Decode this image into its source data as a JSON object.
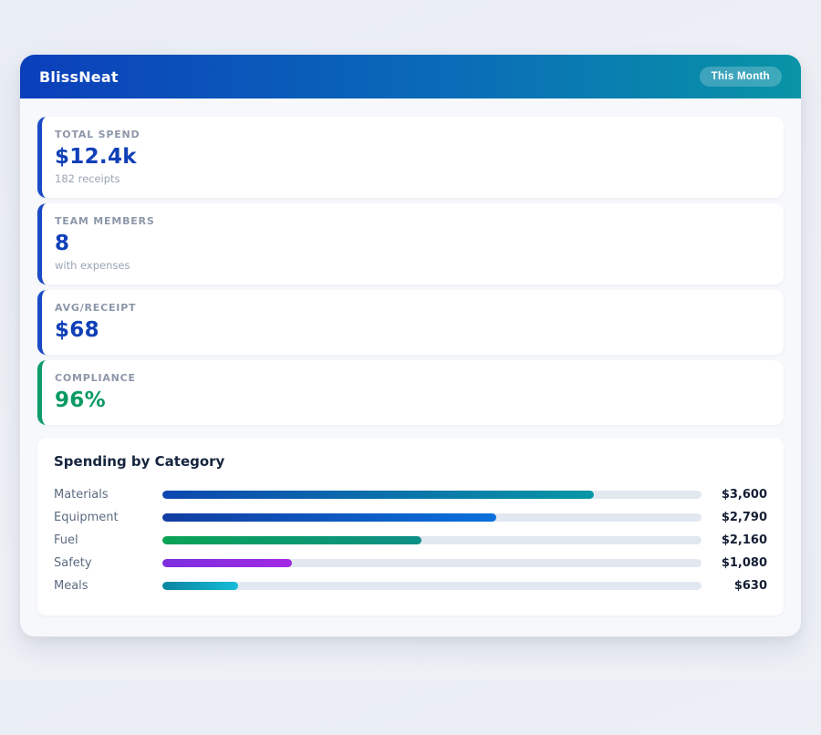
{
  "app": {
    "title": "BlissNeat",
    "period_badge": "This Month",
    "header_gradient": [
      "#0b3fbb",
      "#0894a6"
    ]
  },
  "stats": [
    {
      "label": "TOTAL SPEND",
      "value": "$12.4k",
      "sub": "182 receipts",
      "accent": "#1b4ac6",
      "value_color": "#1040b8"
    },
    {
      "label": "TEAM MEMBERS",
      "value": "8",
      "sub": "with expenses",
      "accent": "#1b4ac6",
      "value_color": "#1040b8"
    },
    {
      "label": "AVG/RECEIPT",
      "value": "$68",
      "accent": "#1b4ac6",
      "value_color": "#1040b8"
    },
    {
      "label": "COMPLIANCE",
      "value": "96%",
      "accent": "#0e9d68",
      "value_color": "#0a9a62"
    }
  ],
  "chart": {
    "title": "Spending by Category",
    "rows": [
      {
        "label": "Materials",
        "value_label": "$3,600",
        "pct": 80,
        "color_start": "#0d47b0",
        "color_end": "#0797a5"
      },
      {
        "label": "Equipment",
        "value_label": "$2,790",
        "pct": 62,
        "color_start": "#113ea2",
        "color_end": "#0b70dd"
      },
      {
        "label": "Fuel",
        "value_label": "$2,160",
        "pct": 48,
        "color_start": "#09a355",
        "color_end": "#0d8f86"
      },
      {
        "label": "Safety",
        "value_label": "$1,080",
        "pct": 24,
        "color_start": "#7c2fdf",
        "color_end": "#a228e4"
      },
      {
        "label": "Meals",
        "value_label": "$630",
        "pct": 14,
        "color_start": "#0b85a0",
        "color_end": "#16bcd8"
      }
    ]
  },
  "chart_data": {
    "type": "bar",
    "orientation": "horizontal",
    "title": "Spending by Category",
    "categories": [
      "Materials",
      "Equipment",
      "Fuel",
      "Safety",
      "Meals"
    ],
    "values": [
      3600,
      2790,
      2160,
      1080,
      630
    ],
    "value_labels": [
      "$3,600",
      "$2,790",
      "$2,160",
      "$1,080",
      "$630"
    ],
    "xlim": [
      0,
      4500
    ],
    "grid": false,
    "legend": false
  }
}
